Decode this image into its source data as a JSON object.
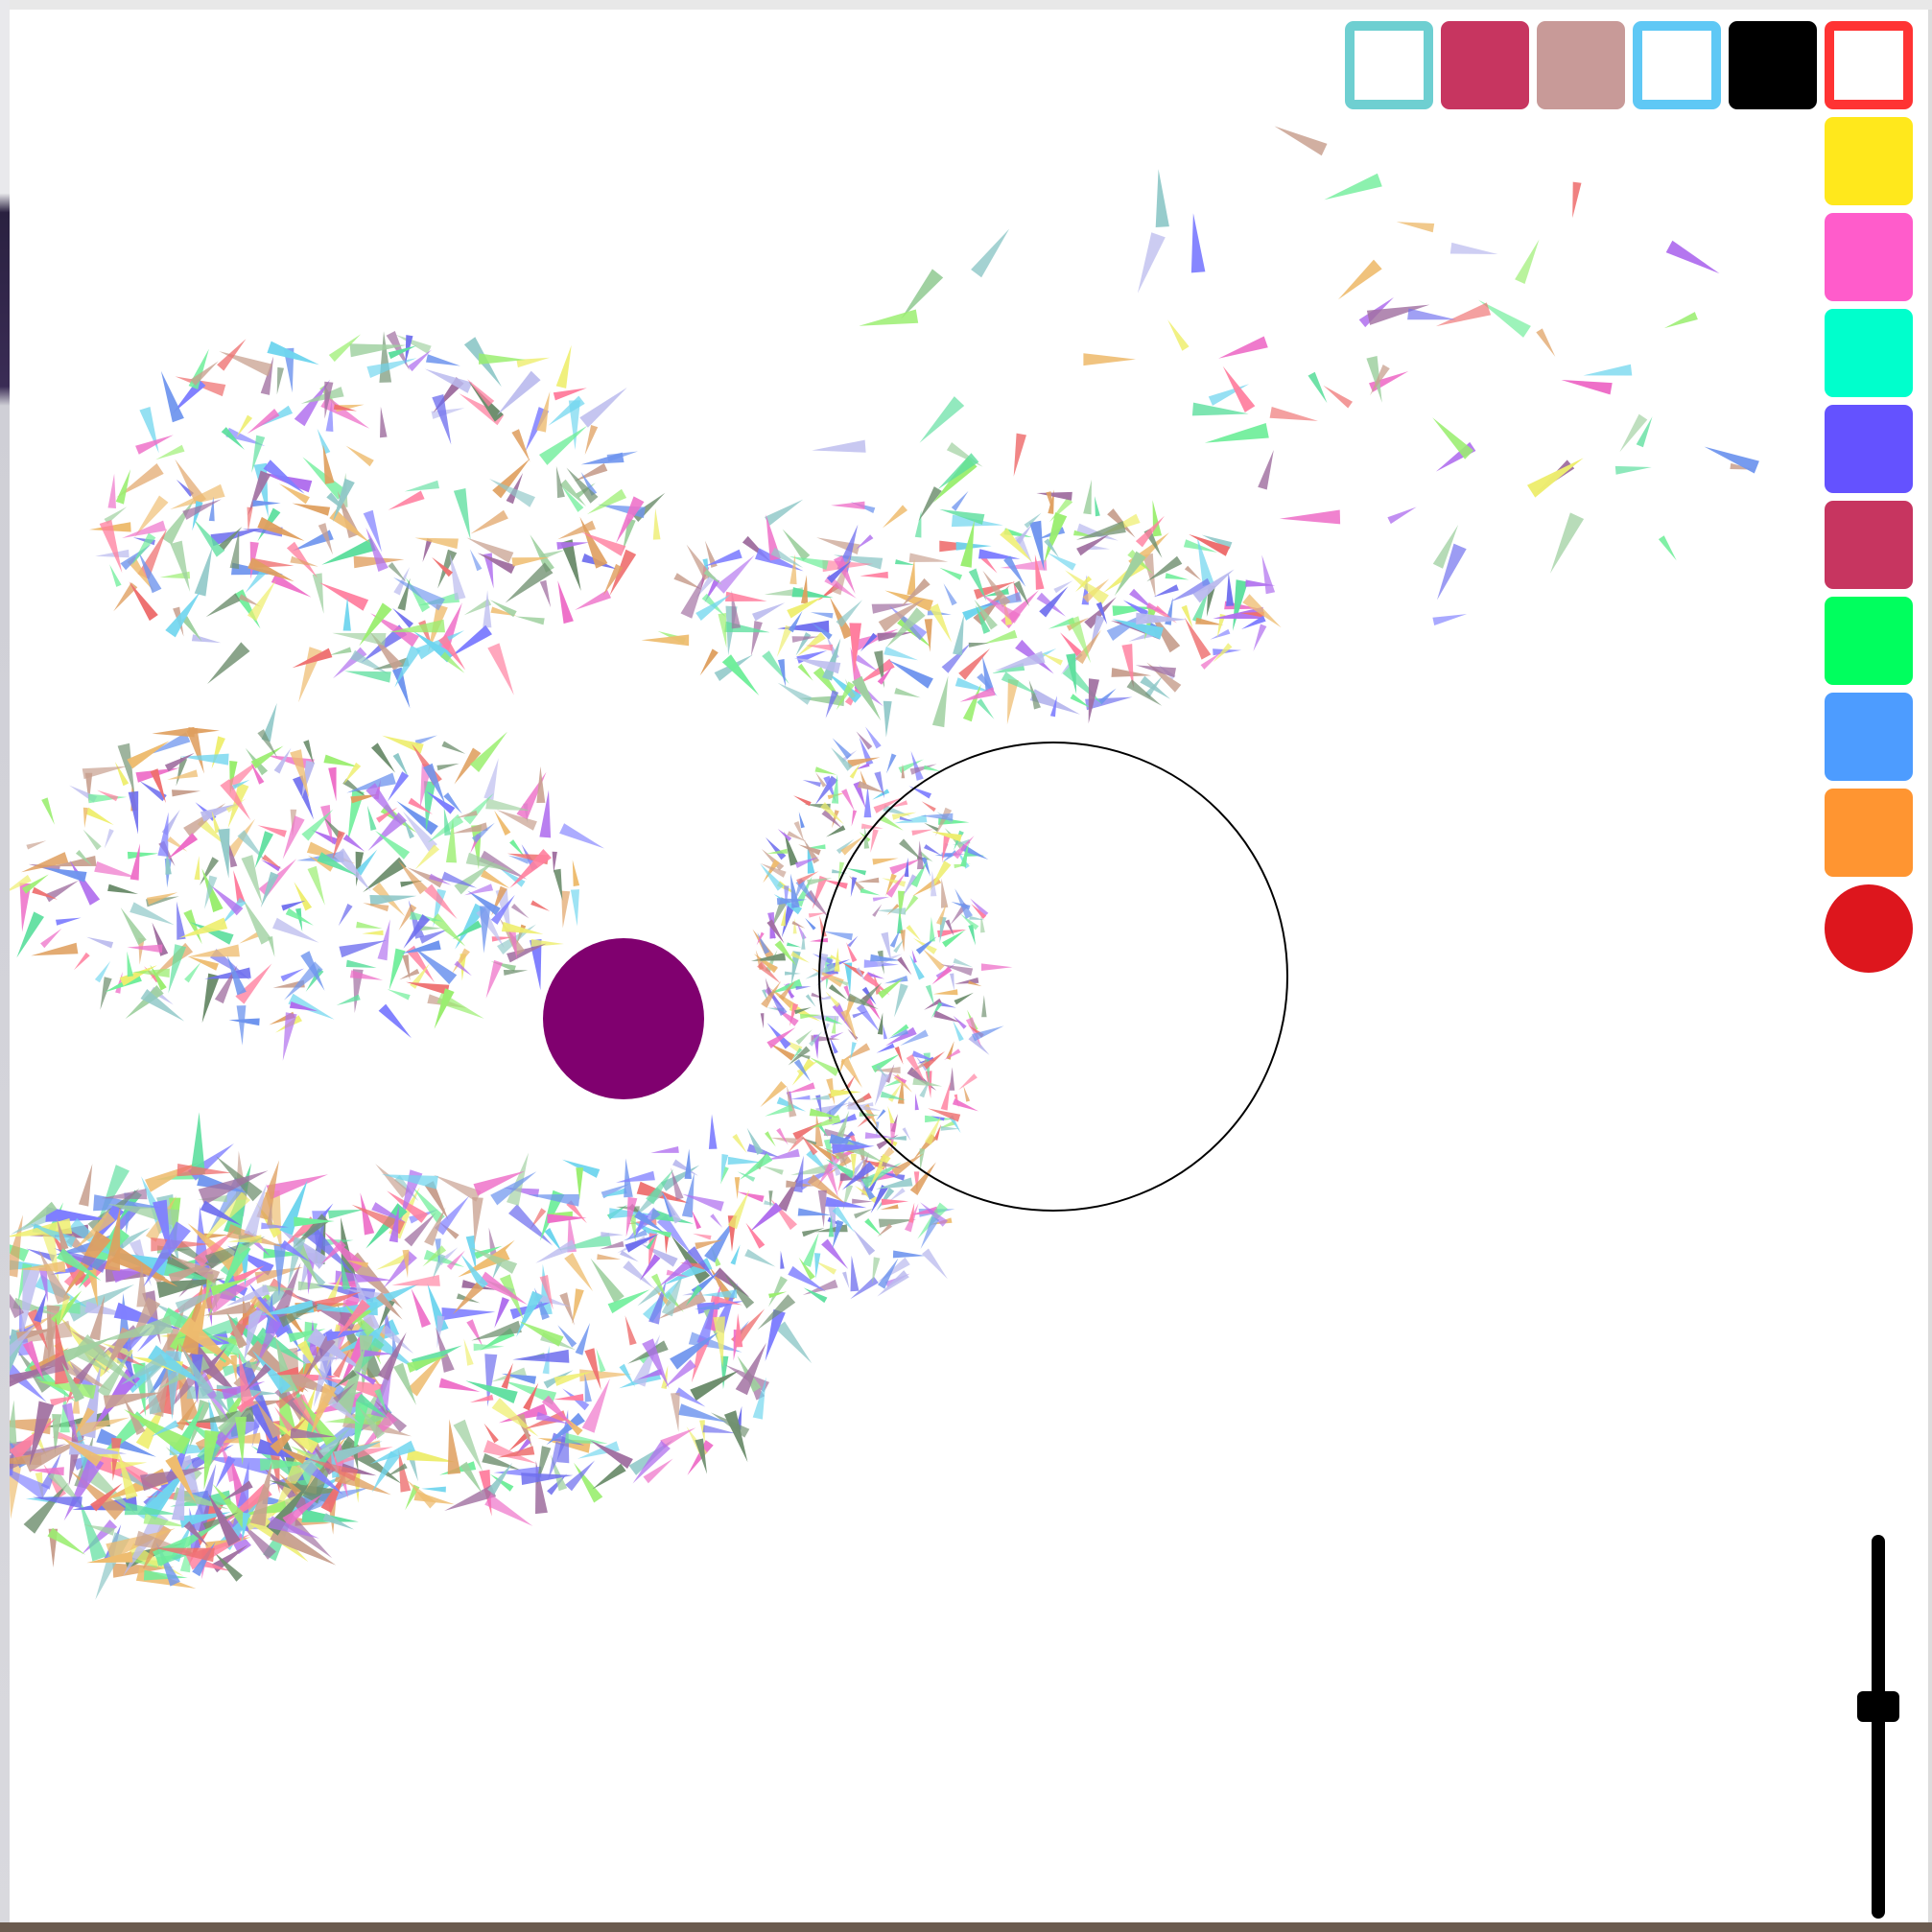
{
  "toolbar": {
    "swatches": [
      {
        "name": "swatch-outline-teal",
        "color": "#6ecfd1",
        "style": "outline"
      },
      {
        "name": "swatch-crimson",
        "color": "#c73560",
        "style": "filled"
      },
      {
        "name": "swatch-dusty-rose",
        "color": "#c89a98",
        "style": "filled"
      },
      {
        "name": "swatch-outline-sky",
        "color": "#5fc8f5",
        "style": "outline"
      },
      {
        "name": "swatch-black",
        "color": "#000000",
        "style": "filled"
      },
      {
        "name": "swatch-outline-red",
        "color": "#ff3333",
        "style": "outline"
      },
      {
        "name": "swatch-yellow",
        "color": "#ffe81c",
        "style": "filled"
      },
      {
        "name": "swatch-pink",
        "color": "#ff5ccb",
        "style": "filled"
      },
      {
        "name": "swatch-aqua",
        "color": "#00ffcc",
        "style": "filled"
      },
      {
        "name": "swatch-violet",
        "color": "#6452ff",
        "style": "filled"
      },
      {
        "name": "swatch-raspberry",
        "color": "#c73560",
        "style": "filled"
      },
      {
        "name": "swatch-green",
        "color": "#00ff5e",
        "style": "filled"
      },
      {
        "name": "swatch-blue",
        "color": "#4d9cff",
        "style": "filled"
      },
      {
        "name": "swatch-orange",
        "color": "#ff9531",
        "style": "filled"
      },
      {
        "name": "swatch-red-circle",
        "color": "#dd161d",
        "style": "circle"
      }
    ]
  },
  "scene": {
    "background": "#ffffff",
    "attractor_color": "#80006f",
    "ring_color": "#000000",
    "particle_palette": [
      "#6f95ee",
      "#ee6f6f",
      "#6fee9a",
      "#eebc6f",
      "#b06fee",
      "#6fd5ee",
      "#ee6fc8",
      "#9aee6f",
      "#6f6fee",
      "#eeee6f",
      "#6f8f6f",
      "#c8a08f",
      "#8fc8c8",
      "#a06fa0",
      "#5fdf9f",
      "#df9f5f",
      "#7f7fff",
      "#ff7f9f",
      "#9fd0a0",
      "#bbbbee"
    ]
  },
  "size_slider": {
    "level": 0.6
  }
}
